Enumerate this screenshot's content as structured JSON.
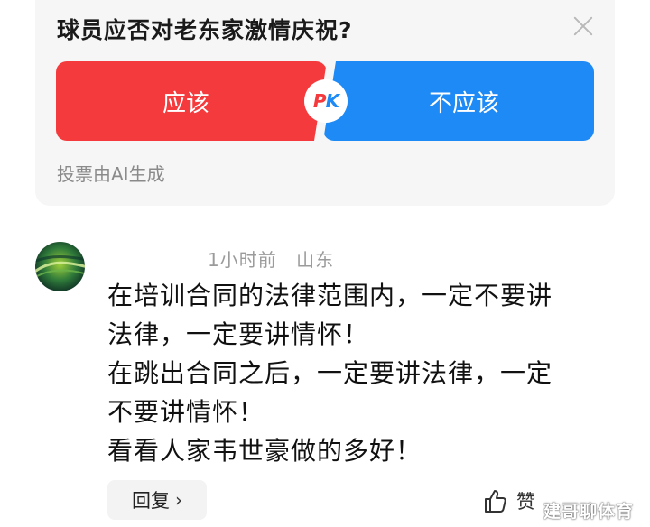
{
  "poll": {
    "title": "球员应否对老东家激情庆祝?",
    "option_yes": "应该",
    "option_no": "不应该",
    "pk_p": "P",
    "pk_k": "K",
    "footnote": "投票由AI生成",
    "colors": {
      "yes": "#f53a3d",
      "no": "#1e8af5"
    },
    "close_icon": "close-icon"
  },
  "comment": {
    "time": "1小时前",
    "location": "山东",
    "lines": [
      "在培训合同的法律范围内，一定不要讲",
      "法律，一定要讲情怀！",
      "在跳出合同之后，一定要讲法律，一定",
      "不要讲情怀！",
      "看看人家韦世豪做的多好！"
    ],
    "reply_label": "回复",
    "like_label": "赞",
    "like_icon": "thumbs-up-icon"
  },
  "watermark": "建哥聊体育"
}
